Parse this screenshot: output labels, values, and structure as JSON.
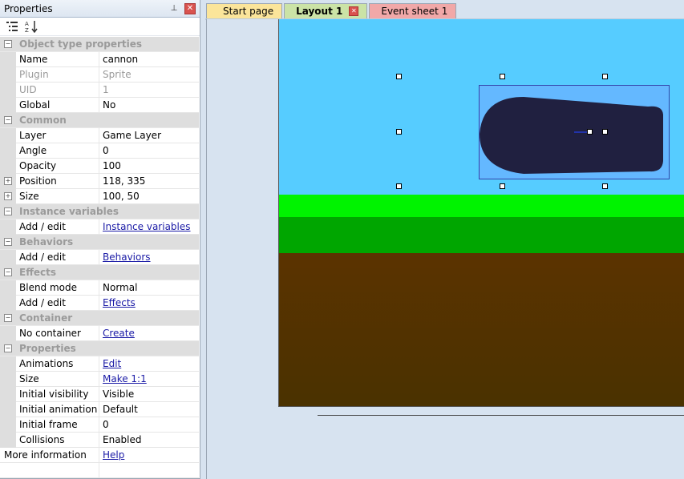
{
  "panel": {
    "title": "Properties",
    "pin_glyph": "⊥",
    "close_glyph": "✕",
    "toolbar": {
      "categorized_icon": "categorized-icon",
      "alphabetical_icon": "sort-az-icon"
    }
  },
  "grid": {
    "object_type": {
      "label": "Object type properties",
      "name": {
        "label": "Name",
        "value": "cannon"
      },
      "plugin": {
        "label": "Plugin",
        "value": "Sprite"
      },
      "uid": {
        "label": "UID",
        "value": "1"
      },
      "global": {
        "label": "Global",
        "value": "No"
      }
    },
    "common": {
      "label": "Common",
      "layer": {
        "label": "Layer",
        "value": "Game Layer"
      },
      "angle": {
        "label": "Angle",
        "value": "0"
      },
      "opacity": {
        "label": "Opacity",
        "value": "100"
      },
      "position": {
        "label": "Position",
        "value": "118, 335"
      },
      "size": {
        "label": "Size",
        "value": "100, 50"
      }
    },
    "instance_vars": {
      "label": "Instance variables",
      "add_edit": {
        "label": "Add / edit",
        "value": "Instance variables"
      }
    },
    "behaviors": {
      "label": "Behaviors",
      "add_edit": {
        "label": "Add / edit",
        "value": "Behaviors"
      }
    },
    "effects": {
      "label": "Effects",
      "blend": {
        "label": "Blend mode",
        "value": "Normal"
      },
      "add_edit": {
        "label": "Add / edit",
        "value": "Effects"
      }
    },
    "container": {
      "label": "Container",
      "no_container": {
        "label": "No container",
        "value": "Create"
      }
    },
    "properties": {
      "label": "Properties",
      "animations": {
        "label": "Animations",
        "value": "Edit"
      },
      "size": {
        "label": "Size",
        "value": "Make 1:1"
      },
      "initial_visibility": {
        "label": "Initial visibility",
        "value": "Visible"
      },
      "initial_animation": {
        "label": "Initial animation",
        "value": "Default"
      },
      "initial_frame": {
        "label": "Initial frame",
        "value": "0"
      },
      "collisions": {
        "label": "Collisions",
        "value": "Enabled"
      }
    },
    "more_info": {
      "label": "More information",
      "value": "Help"
    }
  },
  "tabs": [
    {
      "label": "Start page"
    },
    {
      "label": "Layout 1",
      "close_glyph": "✕"
    },
    {
      "label": "Event sheet 1"
    }
  ],
  "colors": {
    "sky": "#56ccff",
    "grass_light": "#00f300",
    "grass_dark": "#00a600",
    "dirt": "#5b3300",
    "cannon": "#202040",
    "selection_fill": "#64b8ff"
  }
}
